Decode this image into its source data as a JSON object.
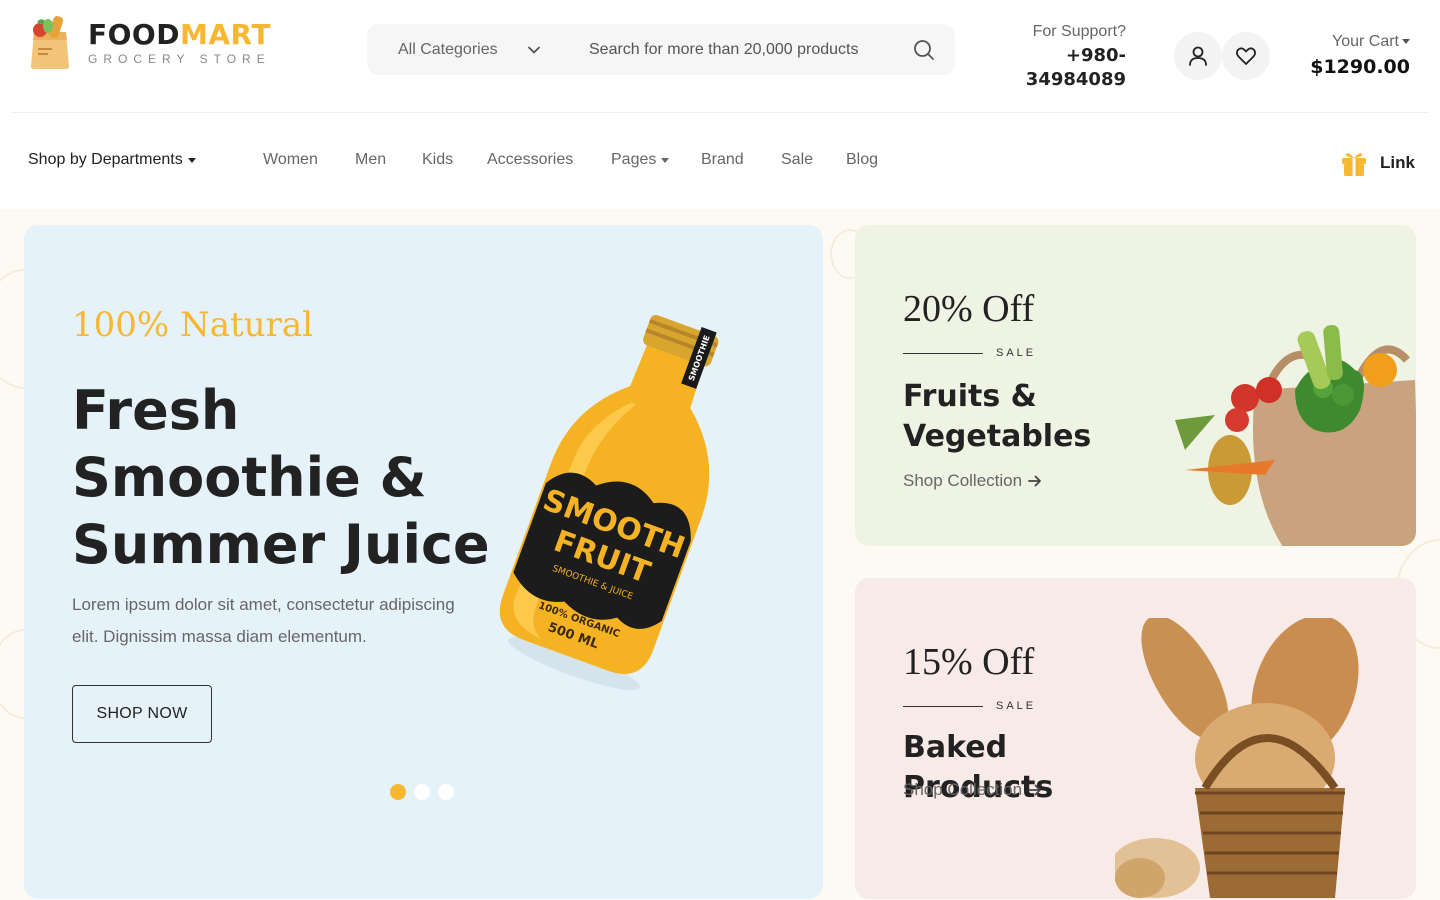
{
  "brand": {
    "name_part1": "FOOD",
    "name_part2": "MART",
    "tagline": "GROCERY STORE",
    "accent_color": "#f7b731"
  },
  "search": {
    "category": "All Categories",
    "placeholder": "Search for more than 20,000 products"
  },
  "support": {
    "label": "For Support?",
    "phone_line1": "+980-",
    "phone_line2": "34984089"
  },
  "cart": {
    "label": "Your Cart",
    "amount": "$1290.00"
  },
  "nav": {
    "departments": "Shop by Departments",
    "links": [
      "Women",
      "Men",
      "Kids",
      "Accessories",
      "Pages",
      "Brand",
      "Sale",
      "Blog"
    ],
    "gift_link": "Link"
  },
  "hero": {
    "tagline": "100% Natural",
    "title": "Fresh Smoothie & Summer Juice",
    "description": "Lorem ipsum dolor sit amet, consectetur adipiscing elit. Dignissim massa diam elementum.",
    "button": "SHOP NOW",
    "bottle_label_1": "SMOOTH",
    "bottle_label_2": "FRUIT",
    "bottle_label_3": "SMOOTHIE & JUICE",
    "bottle_label_4": "100% ORGANIC",
    "bottle_label_5": "500 ML",
    "cap_label": "SMOOTHIE"
  },
  "promos": [
    {
      "discount": "20% Off",
      "sale": "SALE",
      "title": "Fruits & Vegetables",
      "link": "Shop Collection"
    },
    {
      "discount": "15% Off",
      "sale": "SALE",
      "title": "Baked Products",
      "link": "Shop Collection"
    }
  ],
  "icons": {
    "user": "user-icon",
    "heart": "heart-icon",
    "search": "search-icon",
    "gift": "gift-icon"
  }
}
